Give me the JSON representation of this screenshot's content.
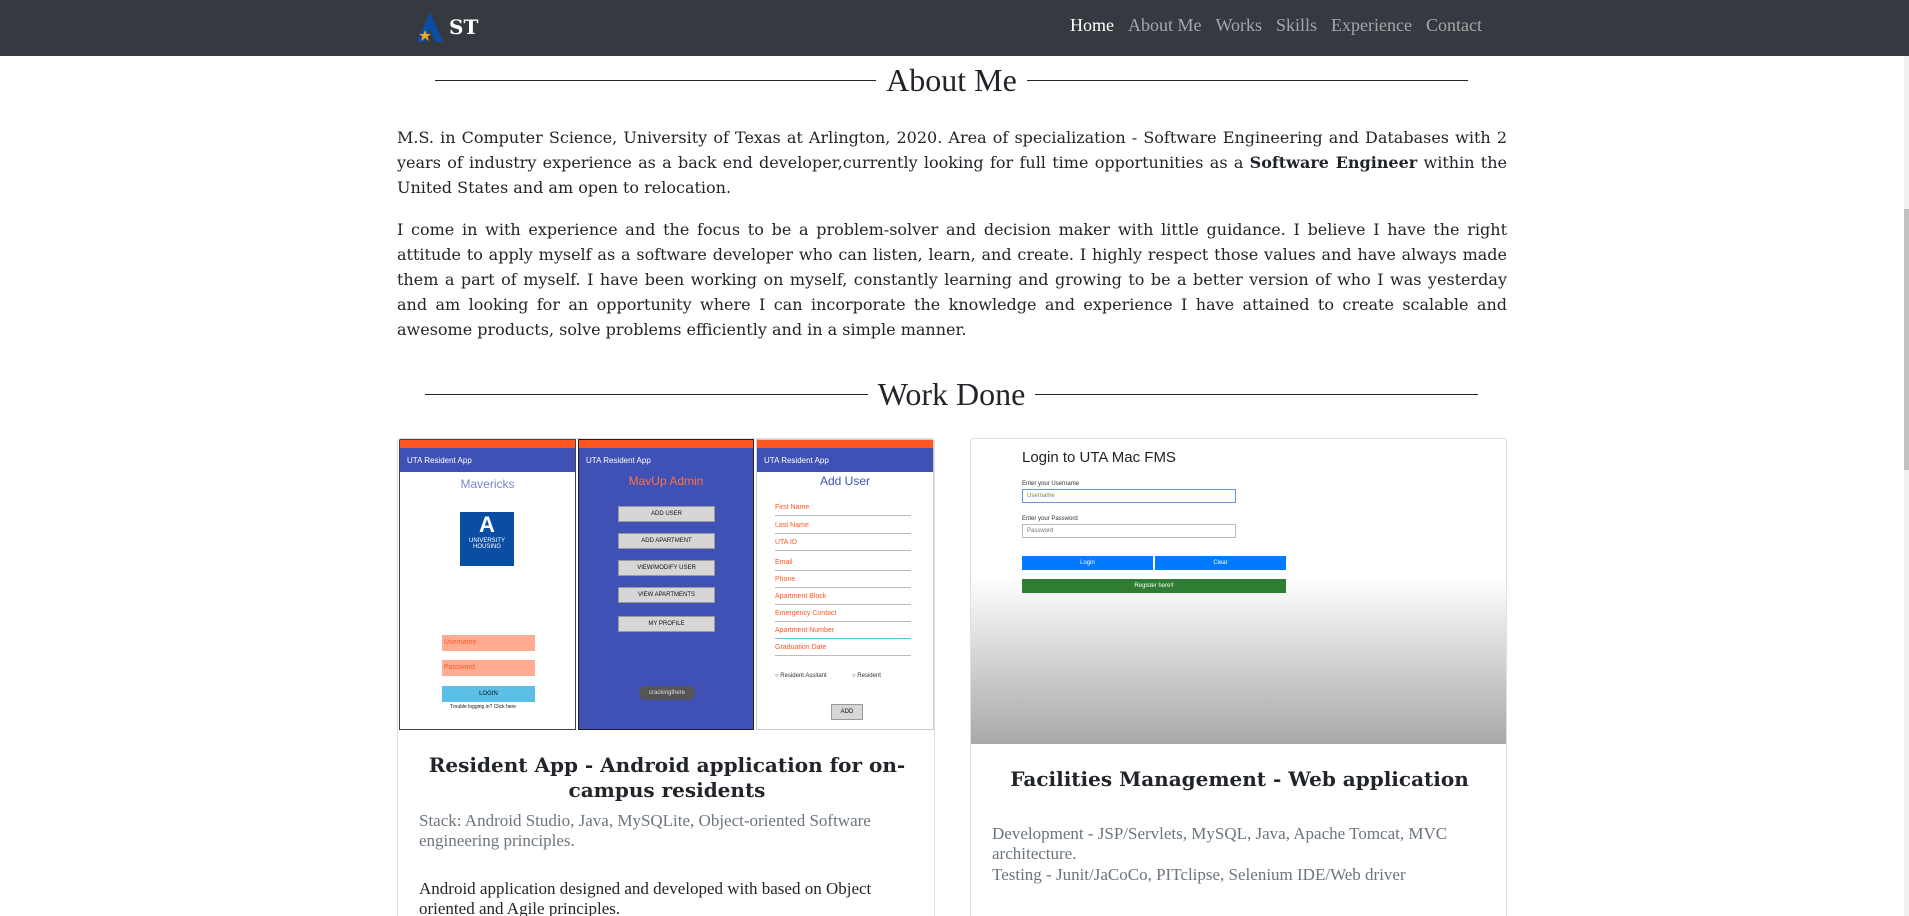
{
  "nav": {
    "brand": "ST",
    "links": [
      "Home",
      "About Me",
      "Works",
      "Skills",
      "Experience",
      "Contact"
    ]
  },
  "about": {
    "heading": "About Me",
    "p1_a": "M.S. in Computer Science, University of Texas at Arlington, 2020. Area of specialization - Software Engineering and Databases with 2 years of industry experience as a back end developer,currently looking for full time opportunities as a ",
    "p1_bold": "Software Engineer",
    "p1_b": " within the United States and am open to relocation.",
    "p2": "I come in with experience and the focus to be a problem-solver and decision maker with little guidance. I believe I have the right attitude to apply myself as a software developer who can listen, learn, and create. I highly respect those values and have always made them a part of myself. I have been working on myself, constantly learning and growing to be a better version of who I was yesterday and am looking for an opportunity where I can incorporate the knowledge and experience I have attained to create scalable and awesome products, solve problems efficiently and in a simple manner."
  },
  "work": {
    "heading": "Work Done",
    "projects": [
      {
        "title": "Resident App - Android application for on-campus residents",
        "stack": "Stack: Android Studio, Java, MySQLite, Object-oriented Software engineering principles.",
        "description": "Android application designed and developed with based on Object oriented and Agile principles.",
        "screens": {
          "app_bar": "UTA Resident App",
          "login_title": "Mavericks",
          "logo_line1": "UNIVERSITY",
          "logo_line2": "HOUSING",
          "username": "Username",
          "password": "Password",
          "login_btn": "LOGIN",
          "trouble": "Trouble logging in? Click here",
          "admin_title": "MavUp Admin",
          "admin_buttons": [
            "ADD USER",
            "ADD APARTMENT",
            "VIEW/MODIFY USER",
            "VIEW APARTMENTS",
            "MY PROFILE"
          ],
          "admin_pill": "crackingthere",
          "add_title": "Add User",
          "add_fields": [
            "First Name",
            "Last Name",
            "UTA ID",
            "Email",
            "Phone",
            "Apartment Block",
            "Emergency Contact",
            "Apartment Number",
            "Graduation Date"
          ],
          "radio1": "Resident Assitant",
          "radio2": "Resident",
          "add_btn": "ADD"
        }
      },
      {
        "title": "Facilities Management - Web application",
        "development": "Development - JSP/Servlets, MySQL, Java, Apache Tomcat, MVC architecture.",
        "testing": "Testing - Junit/JaCoCo, PITclipse, Selenium IDE/Web driver",
        "screen": {
          "title": "Login to UTA Mac FMS",
          "user_label": "Enter your Username",
          "user_placeholder": "Username",
          "pass_label": "Enter your Password",
          "pass_placeholder": "Password",
          "login_btn": "Login",
          "clear_btn": "Clear",
          "register_btn": "Register here!!"
        }
      }
    ]
  },
  "colors": {
    "navbar": "#343a40",
    "android_primary": "#3f51b5",
    "android_accent": "#ff5722",
    "web_button": "#007bff",
    "web_register": "#2e7d32"
  }
}
